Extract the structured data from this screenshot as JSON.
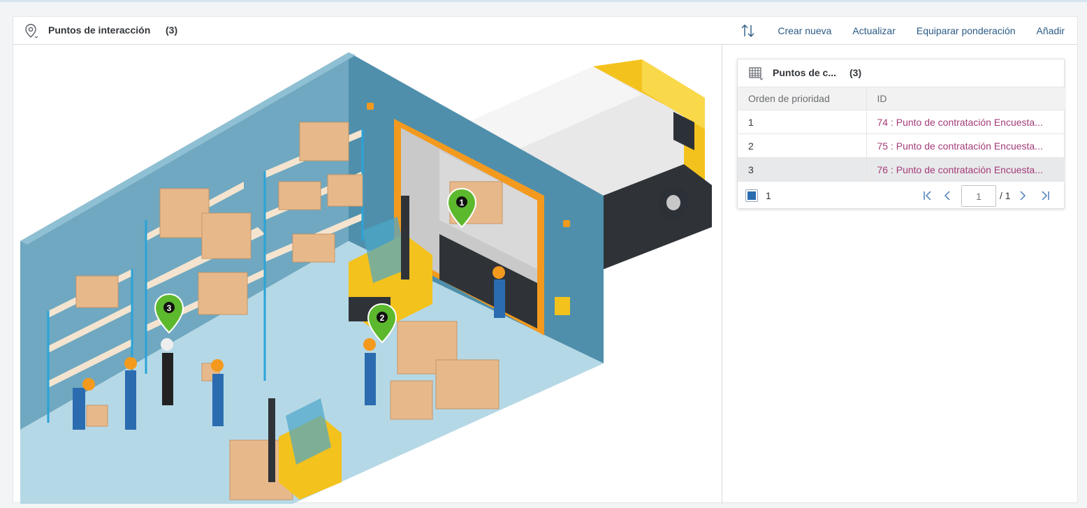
{
  "toolbar": {
    "title": "Puntos de interacción",
    "count": "(3)",
    "actions": {
      "create": "Crear nueva",
      "update": "Actualizar",
      "balance": "Equiparar ponderación",
      "add": "Añadir"
    }
  },
  "scene": {
    "markers": [
      {
        "number": "1",
        "color": "#5cb82d"
      },
      {
        "number": "2",
        "color": "#5cb82d"
      },
      {
        "number": "3",
        "color": "#5cb82d"
      }
    ]
  },
  "table_card": {
    "title": "Puntos de c...",
    "count": "(3)",
    "columns": {
      "priority": "Orden de prioridad",
      "id": "ID"
    },
    "rows": [
      {
        "priority": "1",
        "id": "74 : Punto de contratación Encuesta..."
      },
      {
        "priority": "2",
        "id": "75 : Punto de contratación Encuesta..."
      },
      {
        "priority": "3",
        "id": "76 : Punto de contratación Encuesta..."
      }
    ],
    "pager": {
      "selected_count": "1",
      "page_placeholder": "1",
      "total": "/ 1"
    }
  },
  "colors": {
    "link": "#2b5a85",
    "id_link": "#a43c78",
    "wall": "#5a9bb5",
    "floor": "#b5d8e6"
  }
}
